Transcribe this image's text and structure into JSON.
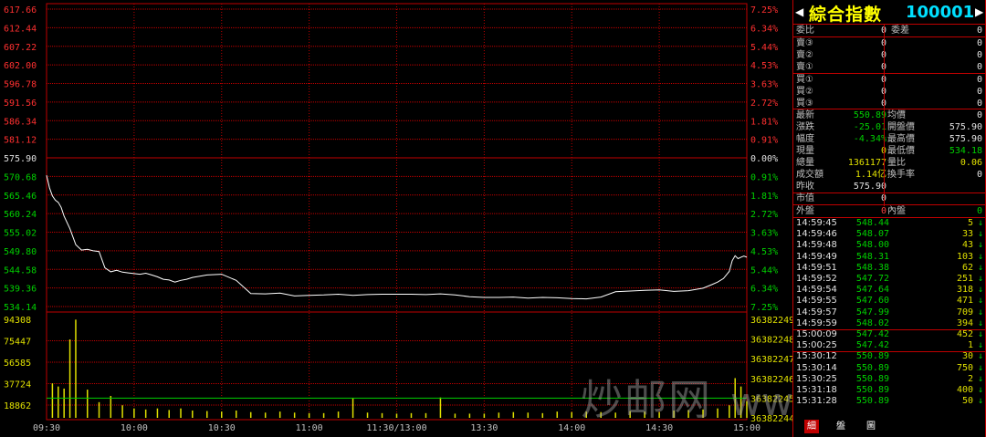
{
  "header": {
    "name": "綜合指數",
    "code": "100001",
    "left_arrow": "◀",
    "right_arrow": "▶"
  },
  "order_book": {
    "ratio_label": "委比",
    "ratio_value": "0",
    "diff_label": "委差",
    "diff_value": "0",
    "sells": [
      {
        "label": "賣③",
        "price": "0",
        "vol": "0"
      },
      {
        "label": "賣②",
        "price": "0",
        "vol": "0"
      },
      {
        "label": "賣①",
        "price": "0",
        "vol": "0"
      }
    ],
    "buys": [
      {
        "label": "買①",
        "price": "0",
        "vol": "0"
      },
      {
        "label": "買②",
        "price": "0",
        "vol": "0"
      },
      {
        "label": "買③",
        "price": "0",
        "vol": "0"
      }
    ]
  },
  "quote": {
    "last_label": "最新",
    "last": "550.89",
    "avg_label": "均價",
    "avg": "0",
    "change_label": "漲跌",
    "change": "-25.01",
    "open_label": "開盤價",
    "open": "575.90",
    "pct_label": "幅度",
    "pct": "-4.34%",
    "high_label": "最高價",
    "high": "575.90",
    "cur_vol_label": "現量",
    "cur_vol": "0",
    "low_label": "最低價",
    "low": "534.18",
    "total_vol_label": "總量",
    "total_vol": "1361177",
    "vol_ratio_label": "量比",
    "vol_ratio": "0.06",
    "amount_label": "成交額",
    "amount": "1.14亿",
    "turnover_label": "換手率",
    "turnover": "0",
    "prev_close_label": "昨收",
    "prev_close": "575.90",
    "mkt_cap_label": "市值",
    "mkt_cap": "0",
    "outer_label": "外盤",
    "outer": "0",
    "inner_label": "內盤",
    "inner": "0"
  },
  "ticks": [
    {
      "time": "14:59:45",
      "price": "548.44",
      "vol": "5"
    },
    {
      "time": "14:59:46",
      "price": "548.07",
      "vol": "33"
    },
    {
      "time": "14:59:48",
      "price": "548.00",
      "vol": "43"
    },
    {
      "time": "14:59:49",
      "price": "548.31",
      "vol": "103"
    },
    {
      "time": "14:59:51",
      "price": "548.38",
      "vol": "62"
    },
    {
      "time": "14:59:52",
      "price": "547.72",
      "vol": "251"
    },
    {
      "time": "14:59:54",
      "price": "547.64",
      "vol": "318"
    },
    {
      "time": "14:59:55",
      "price": "547.60",
      "vol": "471"
    },
    {
      "time": "14:59:57",
      "price": "547.99",
      "vol": "709"
    },
    {
      "time": "14:59:59",
      "price": "548.02",
      "vol": "394"
    },
    {
      "time": "15:00:09",
      "price": "547.42",
      "vol": "452"
    },
    {
      "time": "15:00:25",
      "price": "547.42",
      "vol": "1"
    },
    {
      "time": "15:30:12",
      "price": "550.89",
      "vol": "30"
    },
    {
      "time": "15:30:14",
      "price": "550.89",
      "vol": "750"
    },
    {
      "time": "15:30:25",
      "price": "550.89",
      "vol": "2"
    },
    {
      "time": "15:31:18",
      "price": "550.89",
      "vol": "400"
    },
    {
      "time": "15:31:28",
      "price": "550.89",
      "vol": "50"
    }
  ],
  "tick_arrow": "↓",
  "tabs": [
    "細",
    "盤",
    "圖"
  ],
  "watermark": {
    "cn": "炒邮网",
    "url": "www.cjyou.net"
  },
  "colors": {
    "grid": "#c00000",
    "up": "#ff3030",
    "down": "#00d000",
    "neutral": "#e0e0e0",
    "price_line": "#ffffff",
    "volume": "#e0e000"
  },
  "chart_data": [
    {
      "type": "line",
      "name": "intraday-price",
      "prev_close": 575.9,
      "ylim": [
        534.14,
        617.66
      ],
      "y_ticks_left": [
        "617.66",
        "612.44",
        "607.22",
        "602.00",
        "596.78",
        "591.56",
        "586.34",
        "581.12",
        "575.90",
        "570.68",
        "565.46",
        "560.24",
        "555.02",
        "549.80",
        "544.58",
        "539.36",
        "534.14"
      ],
      "y_ticks_right": [
        "7.25%",
        "6.34%",
        "5.44%",
        "4.53%",
        "3.63%",
        "2.72%",
        "1.81%",
        "0.91%",
        "0.00%",
        "0.91%",
        "1.81%",
        "2.72%",
        "3.63%",
        "4.53%",
        "5.44%",
        "6.34%",
        "7.25%"
      ],
      "x_ticks": [
        "09:30",
        "10:00",
        "10:30",
        "11:00",
        "11:30/13:00",
        "13:30",
        "14:00",
        "14:30",
        "15:00"
      ],
      "x_minutes": 240,
      "series": [
        {
          "x": [
            0,
            1,
            2,
            3,
            4,
            5,
            6,
            8,
            10,
            12,
            14,
            16,
            18,
            20,
            22,
            24,
            26,
            28,
            30,
            32,
            34,
            36,
            38,
            40,
            42,
            44,
            46,
            48,
            50,
            55,
            60,
            65,
            70,
            75,
            80,
            85,
            90,
            95,
            100,
            105,
            110,
            115,
            120,
            125,
            130,
            135,
            140,
            145,
            150,
            155,
            160,
            165,
            170,
            175,
            180,
            185,
            190,
            195,
            200,
            205,
            210,
            215,
            220,
            225,
            228,
            230,
            232,
            234,
            235,
            236,
            237,
            238,
            239,
            240
          ],
          "values": [
            571.0,
            567.5,
            565.2,
            564.0,
            563.4,
            562.0,
            559.5,
            556.0,
            551.5,
            550.0,
            550.2,
            549.8,
            549.6,
            545.0,
            543.9,
            544.3,
            543.8,
            543.6,
            543.4,
            543.2,
            543.5,
            543.0,
            542.5,
            541.8,
            541.6,
            541.0,
            541.5,
            541.8,
            542.3,
            543.0,
            543.2,
            541.5,
            537.8,
            537.7,
            537.9,
            537.1,
            537.3,
            537.4,
            537.6,
            537.3,
            537.5,
            537.6,
            537.6,
            537.6,
            537.5,
            537.7,
            537.4,
            536.9,
            536.7,
            536.7,
            536.8,
            536.5,
            536.7,
            536.6,
            536.4,
            536.3,
            536.8,
            538.3,
            538.5,
            538.7,
            538.8,
            538.4,
            538.6,
            539.3,
            540.3,
            541.0,
            542.0,
            544.0,
            547.0,
            548.4,
            547.6,
            548.0,
            548.3,
            548.0
          ]
        }
      ]
    },
    {
      "type": "bar",
      "name": "intraday-volume",
      "y_ticks_left": [
        "94308",
        "75447",
        "56585",
        "37724",
        "18862"
      ],
      "y_ticks_right": [
        "36382249",
        "36382248",
        "36382247",
        "36382246",
        "36382245",
        "36382244"
      ],
      "ylim": [
        0,
        94308
      ],
      "reference_line": 18862,
      "series": [
        {
          "x": [
            2,
            4,
            6,
            8,
            10,
            14,
            18,
            22,
            26,
            30,
            34,
            38,
            42,
            46,
            50,
            55,
            60,
            65,
            70,
            75,
            80,
            85,
            90,
            95,
            100,
            105,
            110,
            115,
            120,
            125,
            130,
            135,
            140,
            145,
            150,
            155,
            160,
            165,
            170,
            175,
            180,
            185,
            190,
            195,
            200,
            205,
            210,
            215,
            220,
            225,
            230,
            234,
            236,
            238,
            240
          ],
          "values": [
            33000,
            30000,
            28000,
            75000,
            94000,
            27000,
            15000,
            21000,
            12000,
            9000,
            8000,
            9000,
            7500,
            9000,
            7000,
            6500,
            6000,
            7000,
            5500,
            5000,
            6000,
            5000,
            4500,
            4500,
            6000,
            19000,
            5000,
            4500,
            4000,
            4500,
            4500,
            19500,
            4000,
            4000,
            4000,
            5000,
            5500,
            5000,
            4500,
            6000,
            5500,
            6000,
            5500,
            5000,
            6500,
            6000,
            5500,
            7000,
            7500,
            8000,
            9000,
            12000,
            38000,
            30000,
            16000
          ]
        }
      ]
    }
  ]
}
